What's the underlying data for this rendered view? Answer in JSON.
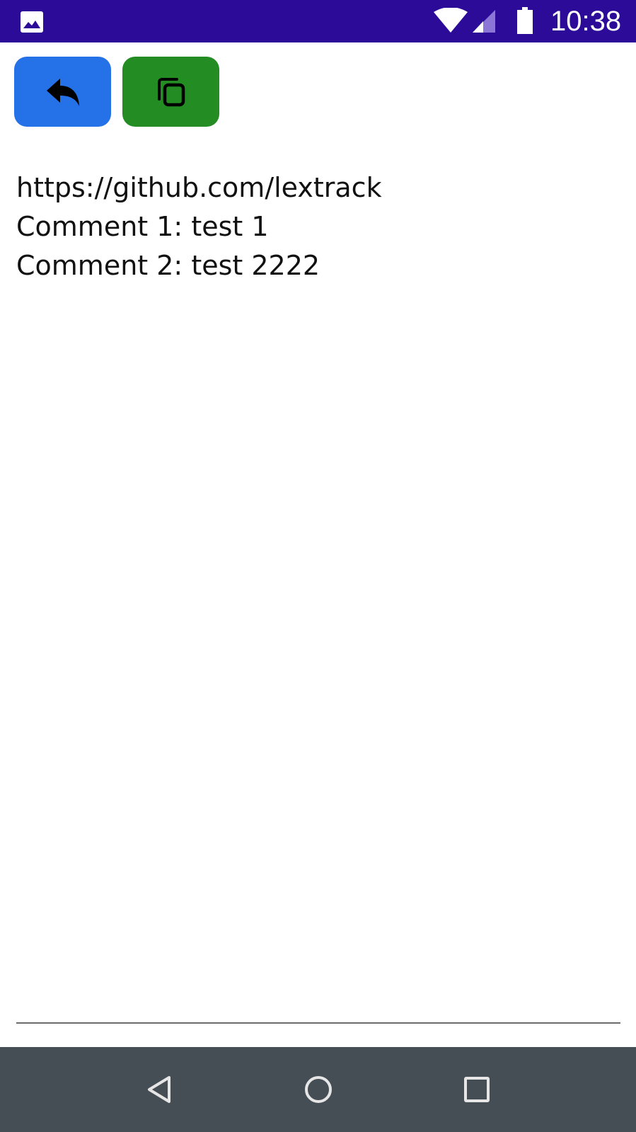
{
  "status_bar": {
    "time": "10:38",
    "icons": [
      "gallery-icon",
      "wifi-icon",
      "signal-icon",
      "battery-icon"
    ],
    "background": "#2c0b99"
  },
  "toolbar": {
    "back_button": {
      "icon": "reply-arrow-icon",
      "color": "#2471e8"
    },
    "copy_button": {
      "icon": "copy-icon",
      "color": "#238c23"
    }
  },
  "content": {
    "lines": [
      "https://github.com/lextrack",
      "Comment 1: test 1",
      "Comment 2: test 2222"
    ]
  },
  "nav_bar": {
    "icons": [
      "nav-back-icon",
      "nav-home-icon",
      "nav-recents-icon"
    ],
    "background": "#454d55"
  }
}
